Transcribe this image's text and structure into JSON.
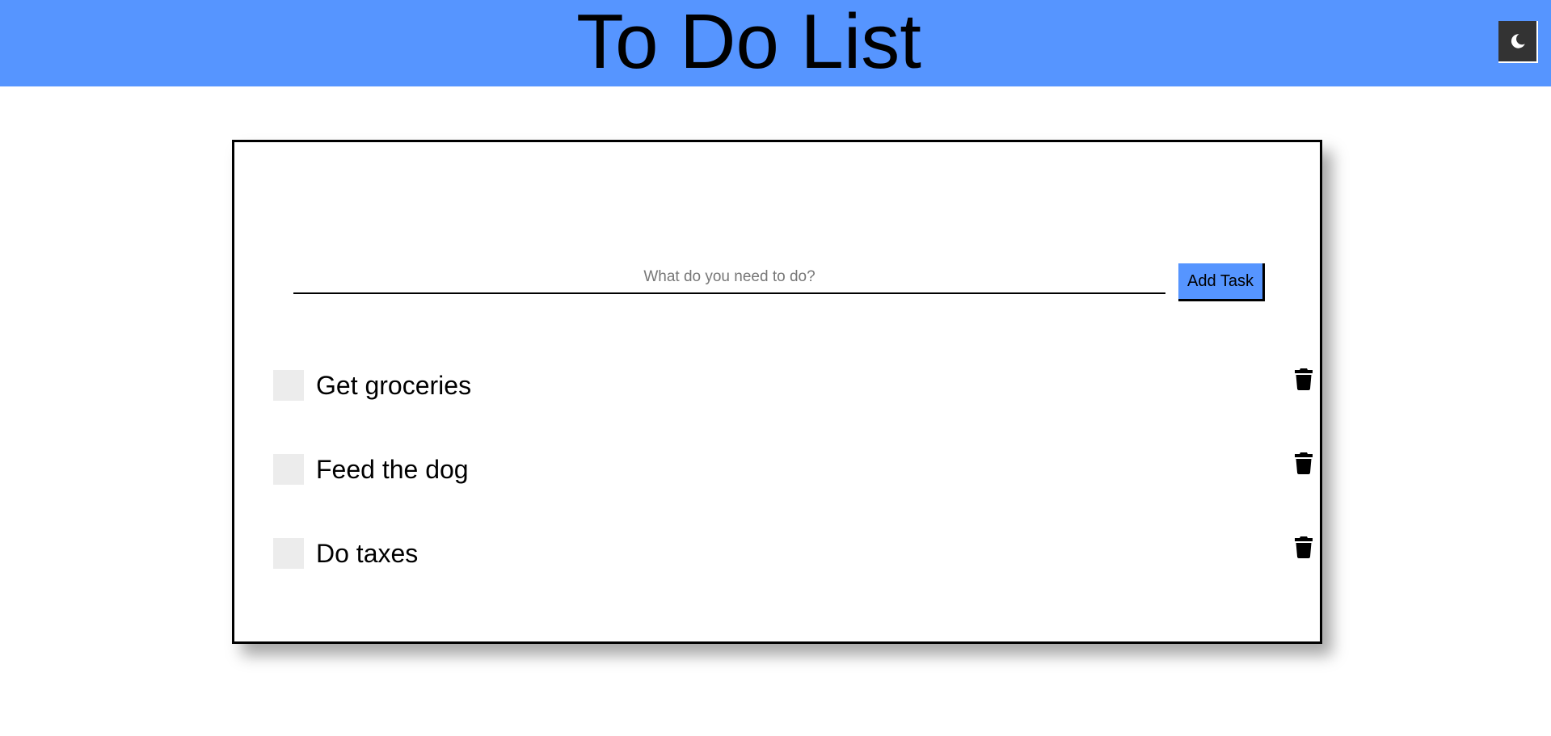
{
  "header": {
    "title": "To Do List",
    "background_color": "#5695ff",
    "theme_toggle": {
      "icon": "moon-icon",
      "background_color": "#333333"
    }
  },
  "new_task": {
    "placeholder": "What do you need to do?",
    "value": "",
    "add_button_label": "Add Task",
    "add_button_color": "#5695ff"
  },
  "tasks": [
    {
      "label": "Get groceries",
      "completed": false,
      "delete_icon": "trash-icon"
    },
    {
      "label": "Feed the dog",
      "completed": false,
      "delete_icon": "trash-icon"
    },
    {
      "label": "Do taxes",
      "completed": false,
      "delete_icon": "trash-icon"
    }
  ]
}
